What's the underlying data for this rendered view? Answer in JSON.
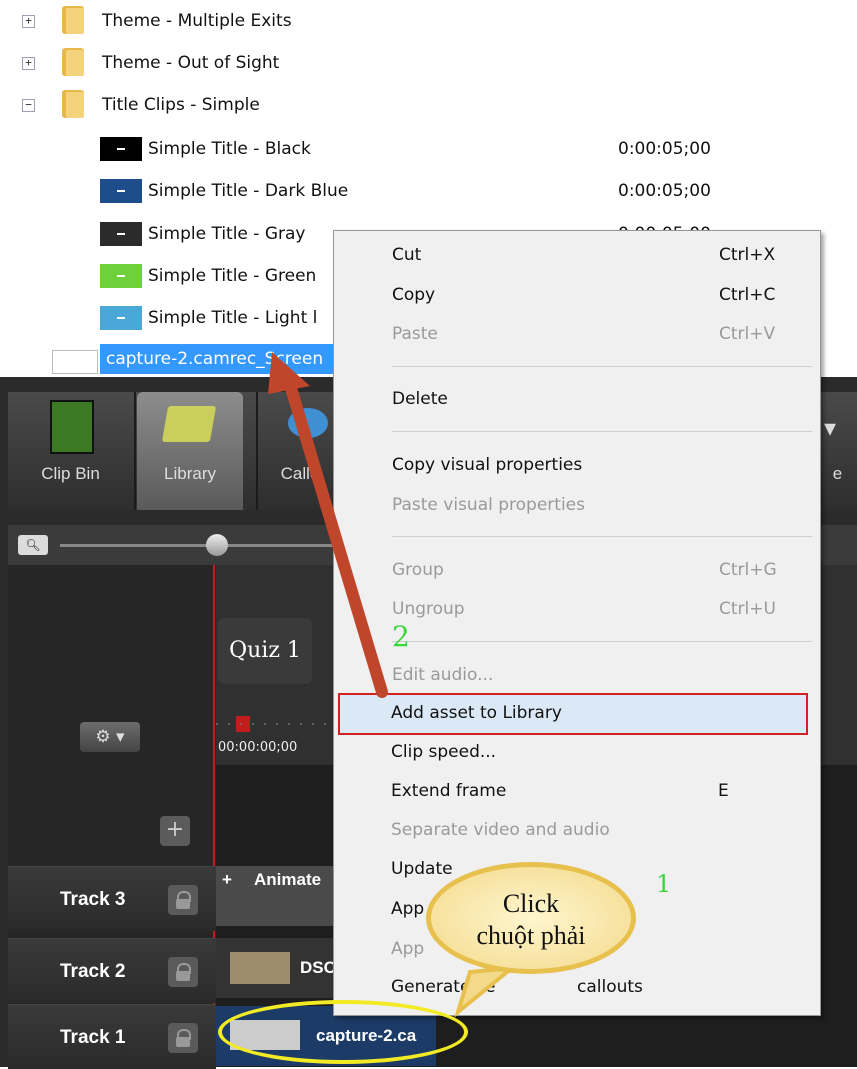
{
  "tree": {
    "folders": [
      {
        "label": "Theme - Multiple Exits",
        "expander": "+"
      },
      {
        "label": "Theme - Out of Sight",
        "expander": "+"
      },
      {
        "label": "Title Clips - Simple",
        "expander": "−"
      }
    ],
    "items": [
      {
        "label": "Simple Title - Black",
        "duration": "0:00:05;00",
        "color": "#000000"
      },
      {
        "label": "Simple Title - Dark Blue",
        "duration": "0:00:05;00",
        "color": "#1e4d8c"
      },
      {
        "label": "Simple Title - Gray",
        "duration": "0:00:05;00",
        "color": "#2b2b2b"
      },
      {
        "label": "Simple Title - Green",
        "duration": "",
        "color": "#6fd13a"
      },
      {
        "label": "Simple Title - Light l",
        "duration": "",
        "color": "#4aa8d8"
      }
    ],
    "selected_item": "capture-2.camrec_Screen"
  },
  "toolbar": {
    "tools": [
      "Clip Bin",
      "Library",
      "Callo",
      "e"
    ]
  },
  "timeline": {
    "quiz_label": "Quiz 1",
    "timecode": "00:00:00;00",
    "gear_label": "⚙ ▾",
    "add_track": "+",
    "tracks": [
      {
        "name": "Track 3",
        "clip": "Animate"
      },
      {
        "name": "Track 2",
        "clip": "DSC"
      },
      {
        "name": "Track 1",
        "clip": "capture-2.ca"
      }
    ]
  },
  "context_menu": {
    "items": [
      {
        "label": "Cut",
        "shortcut": "Ctrl+X",
        "enabled": true
      },
      {
        "label": "Copy",
        "shortcut": "Ctrl+C",
        "enabled": true
      },
      {
        "label": "Paste",
        "shortcut": "Ctrl+V",
        "enabled": false
      },
      {
        "label": "Delete",
        "shortcut": "",
        "enabled": true
      },
      {
        "label": "Copy visual properties",
        "shortcut": "",
        "enabled": true
      },
      {
        "label": "Paste visual properties",
        "shortcut": "",
        "enabled": false
      },
      {
        "label": "Group",
        "shortcut": "Ctrl+G",
        "enabled": false
      },
      {
        "label": "Ungroup",
        "shortcut": "Ctrl+U",
        "enabled": false
      },
      {
        "label": "Edit audio...",
        "shortcut": "",
        "enabled": false
      },
      {
        "label": "Add asset to Library",
        "shortcut": "",
        "enabled": true,
        "highlighted": true
      },
      {
        "label": "Clip speed...",
        "shortcut": "",
        "enabled": true
      },
      {
        "label": "Extend frame",
        "shortcut": "E",
        "enabled": true
      },
      {
        "label": "Separate video and audio",
        "shortcut": "",
        "enabled": false
      },
      {
        "label": "Update",
        "shortcut": "",
        "enabled": true
      },
      {
        "label": "App",
        "shortcut": "",
        "enabled": true
      },
      {
        "label": "App",
        "shortcut": "",
        "enabled": false
      },
      {
        "label": "Generate ke",
        "suffix": "callouts",
        "shortcut": "",
        "enabled": true
      }
    ]
  },
  "annotations": {
    "step2": "2",
    "step1": "1",
    "bubble_line1": "Click",
    "bubble_line2": "chuột phải",
    "arrow_color": "#c0462b",
    "highlight_color": "#d32020",
    "ellipse_color": "#f2ea24"
  }
}
